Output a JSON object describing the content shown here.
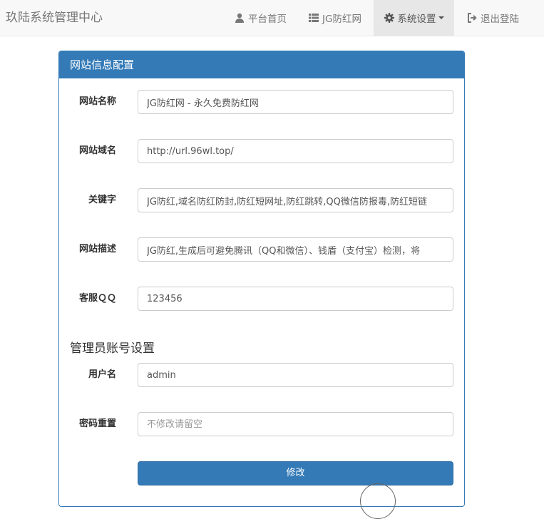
{
  "navbar": {
    "brand": "玖陆系统管理中心",
    "items": [
      {
        "label": "平台首页",
        "icon": "user-icon"
      },
      {
        "label": "JG防红网",
        "icon": "list-icon"
      },
      {
        "label": "系统设置",
        "icon": "gear-icon",
        "active": true,
        "dropdown": true
      },
      {
        "label": "退出登陆",
        "icon": "sign-out-icon"
      }
    ]
  },
  "panel": {
    "title": "网站信息配置",
    "fields": [
      {
        "label": "网站名称",
        "value": "JG防红网 - 永久免费防红网"
      },
      {
        "label": "网站域名",
        "value": "http://url.96wl.top/"
      },
      {
        "label": "关键字",
        "value": "JG防红,域名防红防封,防红短网址,防红跳转,QQ微信防报毒,防红短链"
      },
      {
        "label": "网站描述",
        "value": "JG防红,生成后可避免腾讯（QQ和微信）、钱盾（支付宝）检测，将"
      },
      {
        "label": "客服ＱＱ",
        "value": "123456"
      }
    ],
    "admin_section_title": "管理员账号设置",
    "admin_fields": [
      {
        "label": "用户名",
        "value": "admin",
        "placeholder": ""
      },
      {
        "label": "密码重置",
        "value": "",
        "placeholder": "不修改请留空"
      }
    ],
    "submit_label": "修改"
  },
  "colors": {
    "primary": "#337ab7",
    "navbar_bg": "#f8f8f8",
    "nav_active_bg": "#e7e7e7"
  }
}
